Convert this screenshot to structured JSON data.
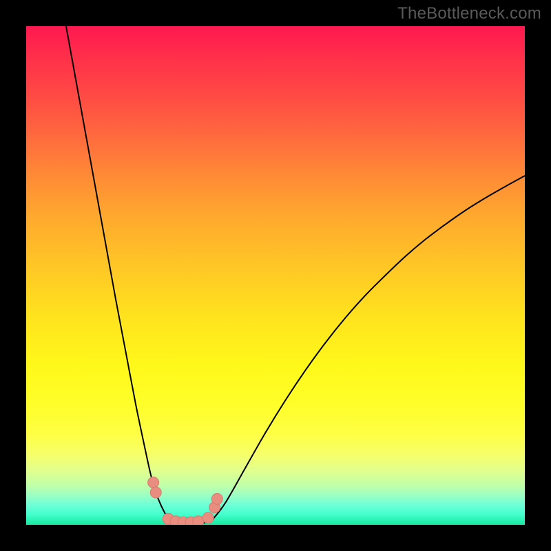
{
  "watermark": "TheBottleneck.com",
  "colors": {
    "frame": "#000000",
    "curve_stroke": "#000000",
    "marker_fill": "#e98d81",
    "marker_stroke": "#d87a6e"
  },
  "chart_data": {
    "type": "line",
    "title": "",
    "xlabel": "",
    "ylabel": "",
    "xlim": [
      0,
      100
    ],
    "ylim": [
      0,
      100
    ],
    "grid": false,
    "legend": false,
    "note": "No axes, ticks, or labels are rendered — values are normalized percentages of the plot area. y=0 is the bottom edge; y=100 is the top edge. Curve shape estimated from pixels.",
    "series": [
      {
        "name": "left-branch",
        "x": [
          8,
          10,
          12,
          14,
          16,
          18,
          20,
          22,
          24,
          25,
          26,
          27,
          28,
          28.5
        ],
        "y": [
          100,
          89,
          78,
          67,
          56,
          45,
          34.5,
          24,
          14.5,
          10,
          6.5,
          4,
          2,
          1
        ]
      },
      {
        "name": "valley-floor",
        "x": [
          28.5,
          30,
          32,
          34,
          36,
          37.5
        ],
        "y": [
          1,
          0.4,
          0.2,
          0.2,
          0.5,
          1.2
        ]
      },
      {
        "name": "right-branch",
        "x": [
          37.5,
          40,
          44,
          48,
          52,
          56,
          60,
          64,
          68,
          72,
          76,
          80,
          84,
          88,
          92,
          96,
          100
        ],
        "y": [
          1.2,
          4.5,
          11.5,
          18.5,
          25,
          31,
          36.5,
          41.5,
          46,
          50,
          53.8,
          57.2,
          60.2,
          63,
          65.5,
          67.8,
          70
        ]
      }
    ],
    "markers": [
      {
        "x": 25.5,
        "y": 8.5
      },
      {
        "x": 26.0,
        "y": 6.5
      },
      {
        "x": 28.5,
        "y": 1.2
      },
      {
        "x": 30.0,
        "y": 0.7
      },
      {
        "x": 31.5,
        "y": 0.5
      },
      {
        "x": 33.0,
        "y": 0.5
      },
      {
        "x": 34.5,
        "y": 0.7
      },
      {
        "x": 36.5,
        "y": 1.4
      },
      {
        "x": 37.8,
        "y": 3.5
      },
      {
        "x": 38.3,
        "y": 5.2
      }
    ]
  }
}
